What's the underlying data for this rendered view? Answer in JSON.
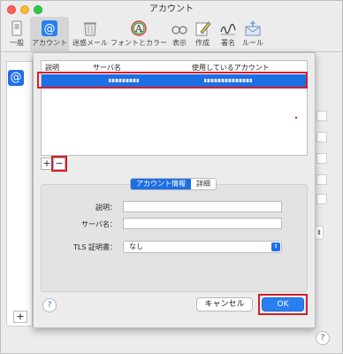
{
  "window": {
    "title": "アカウント"
  },
  "toolbar": {
    "items": [
      {
        "label": "一般",
        "icon": "general-switch-icon"
      },
      {
        "label": "アカウント",
        "icon": "at-sign-icon",
        "active": true
      },
      {
        "label": "迷惑メール",
        "icon": "junk-trash-icon"
      },
      {
        "label": "フォントとカラー",
        "icon": "fonts-colors-icon"
      },
      {
        "label": "表示",
        "icon": "glasses-icon"
      },
      {
        "label": "作成",
        "icon": "compose-pencil-icon"
      },
      {
        "label": "署名",
        "icon": "signature-icon"
      },
      {
        "label": "ルール",
        "icon": "rules-envelope-icon"
      }
    ]
  },
  "sheet": {
    "table": {
      "columns": [
        "説明",
        "サーバ名",
        "使用しているアカウント"
      ]
    },
    "add_symbol": "+",
    "remove_symbol": "−",
    "tabs": {
      "active": "アカウント情報",
      "other": "詳細"
    },
    "form": {
      "description_label": "説明：",
      "server_label": "サーバ名：",
      "tls_label": "TLS 証明書：",
      "tls_value": "なし"
    },
    "help_symbol": "?",
    "cancel_label": "キャンセル",
    "ok_label": "OK"
  },
  "background": {
    "add_symbol": "+",
    "help_symbol": "?",
    "at_symbol": "@"
  },
  "colors": {
    "accent": "#1d6fe4",
    "highlight_border": "#d41f2a"
  }
}
